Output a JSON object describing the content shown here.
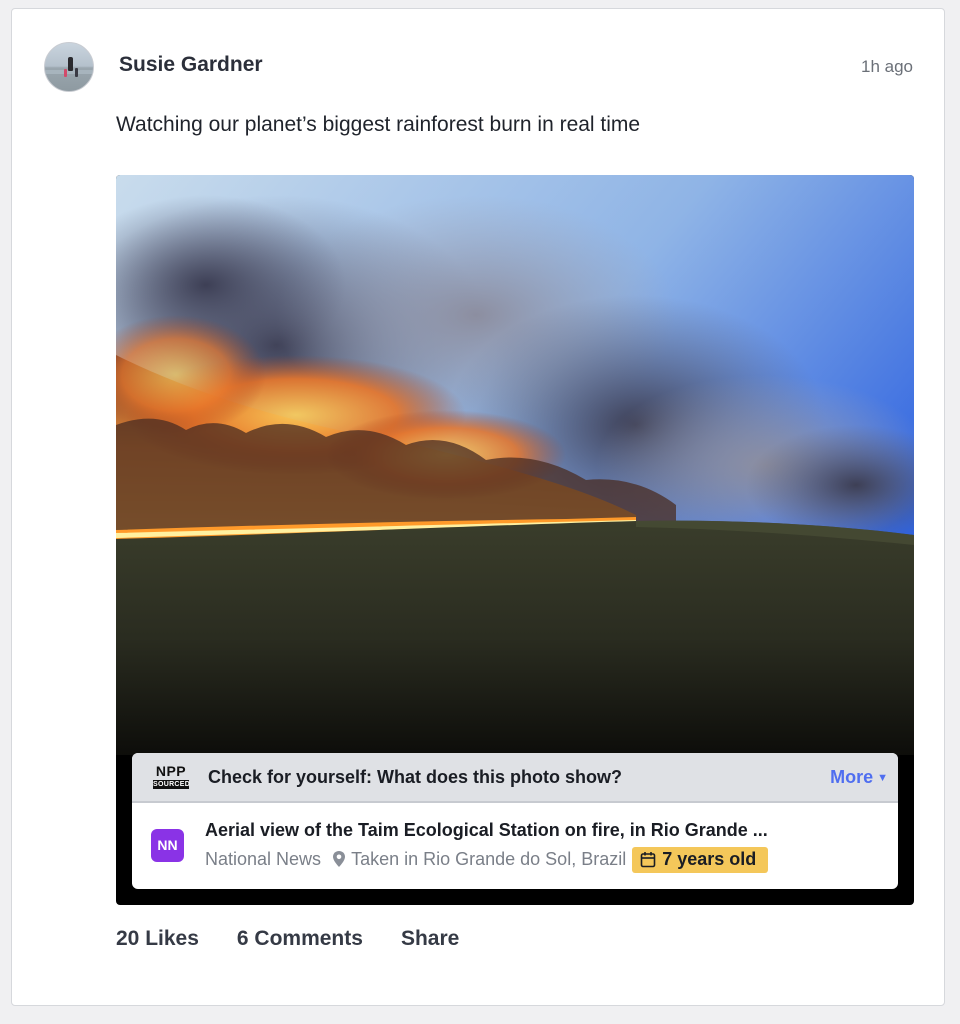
{
  "post": {
    "author": "Susie Gardner",
    "time": "1h ago",
    "text": "Watching our planet’s biggest rainforest burn in real time"
  },
  "check": {
    "badge_top": "NPP",
    "badge_bottom": "SOURCED",
    "title": "Check for yourself: What does this photo show?",
    "more_label": "More",
    "source_logo": "NN",
    "source_title": "Aerial view of the Taim Ecological Station on fire, in Rio Grande ...",
    "source_name": "National News",
    "location": "Taken in Rio Grande do Sol, Brazil",
    "age": "7 years old"
  },
  "actions": {
    "likes": "20 Likes",
    "comments": "6 Comments",
    "share": "Share"
  },
  "colors": {
    "accent": "#4f6ef0",
    "source_logo_bg": "#8a33e6",
    "age_badge": "#f4c75a"
  },
  "icons": [
    "map-pin-icon",
    "calendar-icon",
    "caret-down-icon"
  ]
}
